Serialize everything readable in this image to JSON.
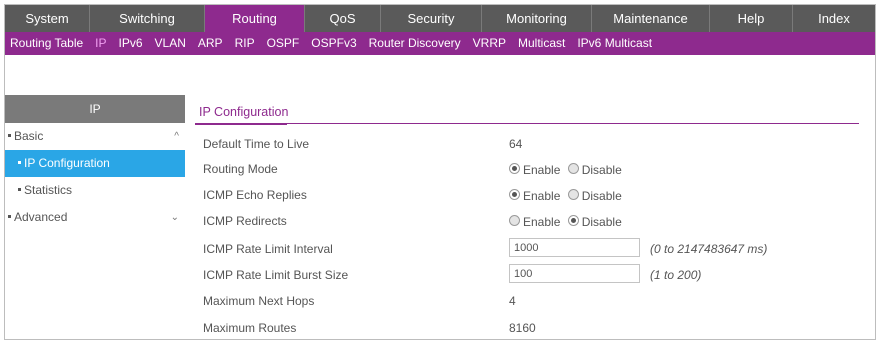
{
  "top_nav": [
    {
      "label": "System"
    },
    {
      "label": "Switching"
    },
    {
      "label": "Routing",
      "active": true
    },
    {
      "label": "QoS"
    },
    {
      "label": "Security"
    },
    {
      "label": "Monitoring"
    },
    {
      "label": "Maintenance"
    },
    {
      "label": "Help"
    },
    {
      "label": "Index"
    }
  ],
  "sub_nav": [
    {
      "label": "Routing Table"
    },
    {
      "label": "IP",
      "active": true
    },
    {
      "label": "IPv6"
    },
    {
      "label": "VLAN"
    },
    {
      "label": "ARP"
    },
    {
      "label": "RIP"
    },
    {
      "label": "OSPF"
    },
    {
      "label": "OSPFv3"
    },
    {
      "label": "Router Discovery"
    },
    {
      "label": "VRRP"
    },
    {
      "label": "Multicast"
    },
    {
      "label": "IPv6 Multicast"
    }
  ],
  "left_panel": {
    "title": "IP",
    "items": [
      {
        "label": "Basic",
        "level": 1,
        "expander": "^"
      },
      {
        "label": "IP Configuration",
        "level": 2,
        "active": true
      },
      {
        "label": "Statistics",
        "level": 2
      },
      {
        "label": "Advanced",
        "level": 1,
        "expander": "v"
      }
    ]
  },
  "content": {
    "tab_label": "IP Configuration",
    "fields": {
      "ttl": {
        "label": "Default Time to Live",
        "value": "64"
      },
      "routing_mode": {
        "label": "Routing Mode",
        "enable": "Enable",
        "disable": "Disable",
        "selected": "Enable"
      },
      "icmp_echo": {
        "label": "ICMP Echo Replies",
        "enable": "Enable",
        "disable": "Disable",
        "selected": "Enable"
      },
      "icmp_redirects": {
        "label": "ICMP Redirects",
        "enable": "Enable",
        "disable": "Disable",
        "selected": "Disable"
      },
      "rate_interval": {
        "label": "ICMP Rate Limit Interval",
        "value": "1000",
        "hint": "(0 to 2147483647 ms)"
      },
      "burst_size": {
        "label": "ICMP Rate Limit Burst Size",
        "value": "100",
        "hint": "(1 to 200)"
      },
      "max_next_hops": {
        "label": "Maximum Next Hops",
        "value": "4"
      },
      "max_routes": {
        "label": "Maximum Routes",
        "value": "8160"
      }
    }
  },
  "colors": {
    "nav_bg": "#5a5a5a",
    "accent": "#8e2a8e",
    "sub_active": "#f1a0f1",
    "menu_active": "#2aa6e6"
  }
}
